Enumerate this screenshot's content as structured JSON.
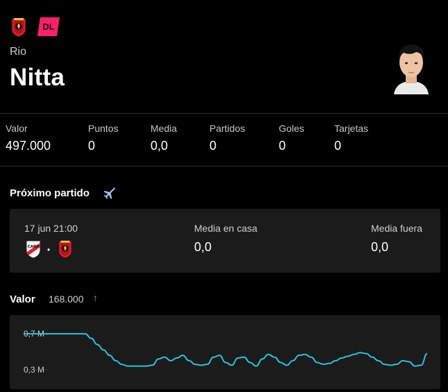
{
  "player": {
    "first_name": "Rio",
    "last_name": "Nitta",
    "position": "DL",
    "team_icon": "urawa-crest-icon",
    "avatar_icon": "player-photo"
  },
  "colors": {
    "background": "#000000",
    "card": "#1b1b1b",
    "position_badge": "#ff1f6b",
    "trend_up": "#2ecc71",
    "chart_line": "#27c3dc"
  },
  "stats": [
    {
      "label": "Valor",
      "value": "497.000"
    },
    {
      "label": "Puntos",
      "value": "0"
    },
    {
      "label": "Media",
      "value": "0,0"
    },
    {
      "label": "Partidos",
      "value": "0"
    },
    {
      "label": "Goles",
      "value": "0"
    },
    {
      "label": "Tarjetas",
      "value": "0"
    }
  ],
  "next_match": {
    "title": "Próximo partido",
    "travel_icon": "plane-icon",
    "date": "17 jun 21:00",
    "separator": "•",
    "home_team_icon": "river-plate-crest-icon",
    "away_team_icon": "urawa-crest-icon",
    "home_avg_label": "Media en casa",
    "home_avg_value": "0,0",
    "away_avg_label": "Media fuera",
    "away_avg_value": "0,0"
  },
  "valor": {
    "title": "Valor",
    "change": "168.000",
    "trend_icon": "arrow-up-icon",
    "trend_glyph": "↑"
  },
  "chart_data": {
    "type": "line",
    "title": "",
    "xlabel": "",
    "ylabel": "",
    "y_ticks": [
      {
        "value": 0.7,
        "label": "0,7 M"
      },
      {
        "value": 0.3,
        "label": "0,3 M"
      }
    ],
    "ylim": [
      0.26,
      0.74
    ],
    "grid": false,
    "series": [
      {
        "values": [
          0.7,
          0.7,
          0.7,
          0.7,
          0.7,
          0.7,
          0.7,
          0.65,
          0.58,
          0.52,
          0.46,
          0.4,
          0.36,
          0.34,
          0.34,
          0.34,
          0.34,
          0.35,
          0.42,
          0.44,
          0.4,
          0.43,
          0.46,
          0.4,
          0.36,
          0.35,
          0.36,
          0.44,
          0.46,
          0.38,
          0.35,
          0.43,
          0.44,
          0.38,
          0.34,
          0.42,
          0.47,
          0.44,
          0.38,
          0.35,
          0.4,
          0.46,
          0.47,
          0.44,
          0.38,
          0.36,
          0.37,
          0.4,
          0.43,
          0.45,
          0.47,
          0.49,
          0.48,
          0.44,
          0.4,
          0.36,
          0.35,
          0.36,
          0.4,
          0.39,
          0.34,
          0.35,
          0.48
        ]
      }
    ]
  }
}
